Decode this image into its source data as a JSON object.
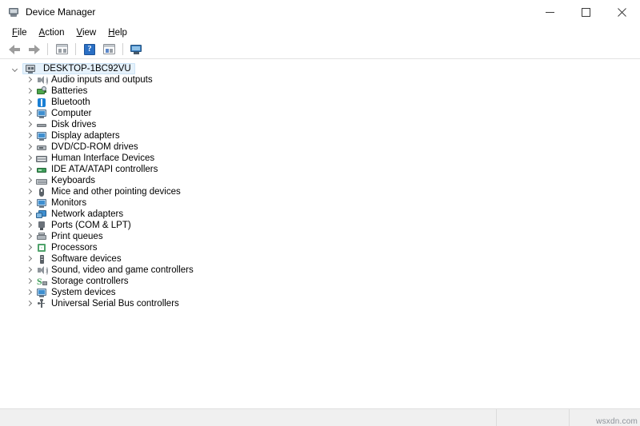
{
  "window": {
    "title": "Device Manager",
    "app_icon": "device-manager-icon",
    "controls": {
      "minimize": "minimize-icon",
      "maximize": "maximize-icon",
      "close": "close-icon"
    }
  },
  "menubar": {
    "items": [
      {
        "label": "File",
        "accel": "F",
        "rest": "ile"
      },
      {
        "label": "Action",
        "accel": "A",
        "rest": "ction"
      },
      {
        "label": "View",
        "accel": "V",
        "rest": "iew"
      },
      {
        "label": "Help",
        "accel": "H",
        "rest": "elp"
      }
    ]
  },
  "toolbar": {
    "buttons": [
      {
        "name": "back-button",
        "icon": "back-arrow-icon",
        "enabled": false
      },
      {
        "name": "forward-button",
        "icon": "forward-arrow-icon",
        "enabled": false
      },
      {
        "name": "show-hide-console-tree-button",
        "icon": "console-tree-icon",
        "enabled": true
      },
      {
        "name": "help-button",
        "icon": "help-question-icon",
        "enabled": true
      },
      {
        "name": "properties-button",
        "icon": "properties-icon",
        "enabled": true
      },
      {
        "name": "scan-for-hardware-changes-button",
        "icon": "scan-hardware-icon",
        "enabled": true
      }
    ]
  },
  "tree": {
    "root": {
      "label": "DESKTOP-1BC92VU",
      "icon": "computer-root-icon",
      "expanded": true,
      "selected": true
    },
    "items": [
      {
        "label": "Audio inputs and outputs",
        "icon": "speaker-icon",
        "icon_class": "speaker"
      },
      {
        "label": "Batteries",
        "icon": "battery-icon",
        "icon_class": "battery"
      },
      {
        "label": "Bluetooth",
        "icon": "bluetooth-icon",
        "icon_class": "bt"
      },
      {
        "label": "Computer",
        "icon": "computer-icon",
        "icon_class": "monitor"
      },
      {
        "label": "Disk drives",
        "icon": "disk-drive-icon",
        "icon_class": "disk"
      },
      {
        "label": "Display adapters",
        "icon": "display-adapter-icon",
        "icon_class": "monitor"
      },
      {
        "label": "DVD/CD-ROM drives",
        "icon": "dvd-drive-icon",
        "icon_class": "dvd"
      },
      {
        "label": "Human Interface Devices",
        "icon": "hid-icon",
        "icon_class": "hid"
      },
      {
        "label": "IDE ATA/ATAPI controllers",
        "icon": "ide-controller-icon",
        "icon_class": "ide"
      },
      {
        "label": "Keyboards",
        "icon": "keyboard-icon",
        "icon_class": "kbd"
      },
      {
        "label": "Mice and other pointing devices",
        "icon": "mouse-icon",
        "icon_class": "mouse"
      },
      {
        "label": "Monitors",
        "icon": "monitor-icon",
        "icon_class": "monitor"
      },
      {
        "label": "Network adapters",
        "icon": "network-adapter-icon",
        "icon_class": "net"
      },
      {
        "label": "Ports (COM & LPT)",
        "icon": "port-icon",
        "icon_class": "port"
      },
      {
        "label": "Print queues",
        "icon": "printer-icon",
        "icon_class": "print"
      },
      {
        "label": "Processors",
        "icon": "processor-icon",
        "icon_class": "cpu"
      },
      {
        "label": "Software devices",
        "icon": "software-device-icon",
        "icon_class": "soft"
      },
      {
        "label": "Sound, video and game controllers",
        "icon": "sound-controller-icon",
        "icon_class": "speaker"
      },
      {
        "label": "Storage controllers",
        "icon": "storage-controller-icon",
        "icon_class": "stor"
      },
      {
        "label": "System devices",
        "icon": "system-device-icon",
        "icon_class": "monitor"
      },
      {
        "label": "Universal Serial Bus controllers",
        "icon": "usb-controller-icon",
        "icon_class": "usb"
      }
    ]
  },
  "statusbar": {
    "main_text": "",
    "panel2_text": "",
    "panel3_text": ""
  },
  "watermark": {
    "text": "wsxdn.com"
  },
  "colors": {
    "selection_fill": "#e5f1fb",
    "selection_border": "#cce4f7",
    "statusbar_bg": "#f0f0f0",
    "accent_blue": "#3f8fd0"
  }
}
